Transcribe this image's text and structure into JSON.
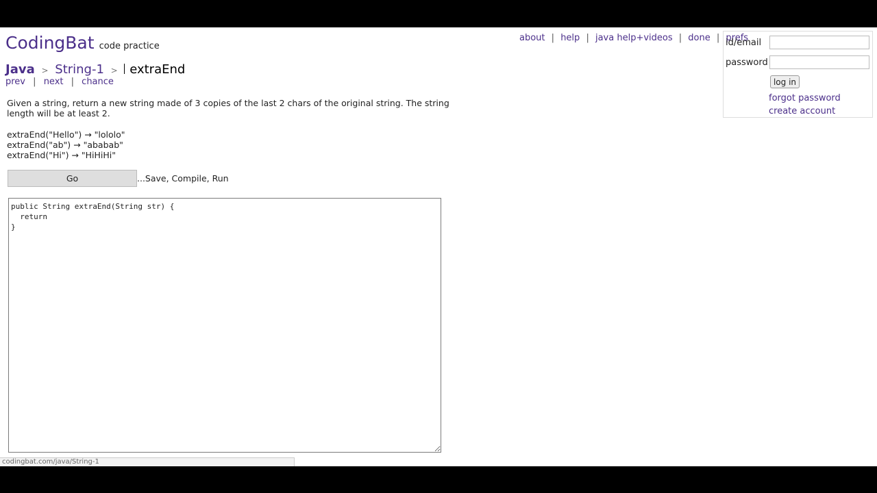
{
  "header": {
    "logo": "CodingBat",
    "tagline": "code practice"
  },
  "breadcrumb": {
    "language": "Java",
    "separator": ">",
    "section": "String-1",
    "problem": "extraEnd"
  },
  "problem_nav": {
    "prev": "prev",
    "next": "next",
    "chance": "chance",
    "divider": "|"
  },
  "problem": {
    "description": "Given a string, return a new string made of 3 copies of the last 2 chars of the original string. The string length will be at least 2.",
    "examples": [
      "extraEnd(\"Hello\") → \"lololo\"",
      "extraEnd(\"ab\") → \"ababab\"",
      "extraEnd(\"Hi\") → \"HiHiHi\""
    ]
  },
  "run": {
    "go_label": "Go",
    "note": "...Save, Compile, Run"
  },
  "editor": {
    "code": "public String extraEnd(String str) {\n  return\n}"
  },
  "top_links": {
    "about": "about",
    "help": "help",
    "java_help": "java help+videos",
    "done": "done",
    "prefs": "prefs",
    "divider": "|"
  },
  "login": {
    "id_label": "id/email",
    "password_label": "password",
    "id_value": "",
    "password_value": "",
    "login_button": "log in",
    "forgot_password": "forgot password",
    "create_account": "create account"
  },
  "status_bar": {
    "url": "codingbat.com/java/String-1"
  },
  "colors": {
    "brand_purple": "#4b2f8a",
    "frame_black": "#000000",
    "button_gray": "#dedede"
  }
}
